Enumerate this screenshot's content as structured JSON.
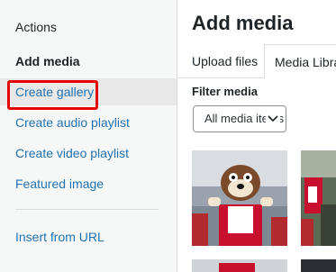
{
  "sidebar": {
    "heading": "Actions",
    "items": [
      {
        "label": "Add media"
      },
      {
        "label": "Create gallery"
      },
      {
        "label": "Create audio playlist"
      },
      {
        "label": "Create video playlist"
      },
      {
        "label": "Featured image"
      },
      {
        "label": "Insert from URL"
      }
    ]
  },
  "main": {
    "title": "Add media",
    "tabs": [
      {
        "label": "Upload files"
      },
      {
        "label": "Media Library"
      }
    ],
    "filter": {
      "label": "Filter media",
      "selected": "All media items"
    }
  },
  "icons": {
    "dropdown": "chevron-down-icon"
  },
  "colors": {
    "link": "#2271b1",
    "highlight_box": "#e60000"
  }
}
